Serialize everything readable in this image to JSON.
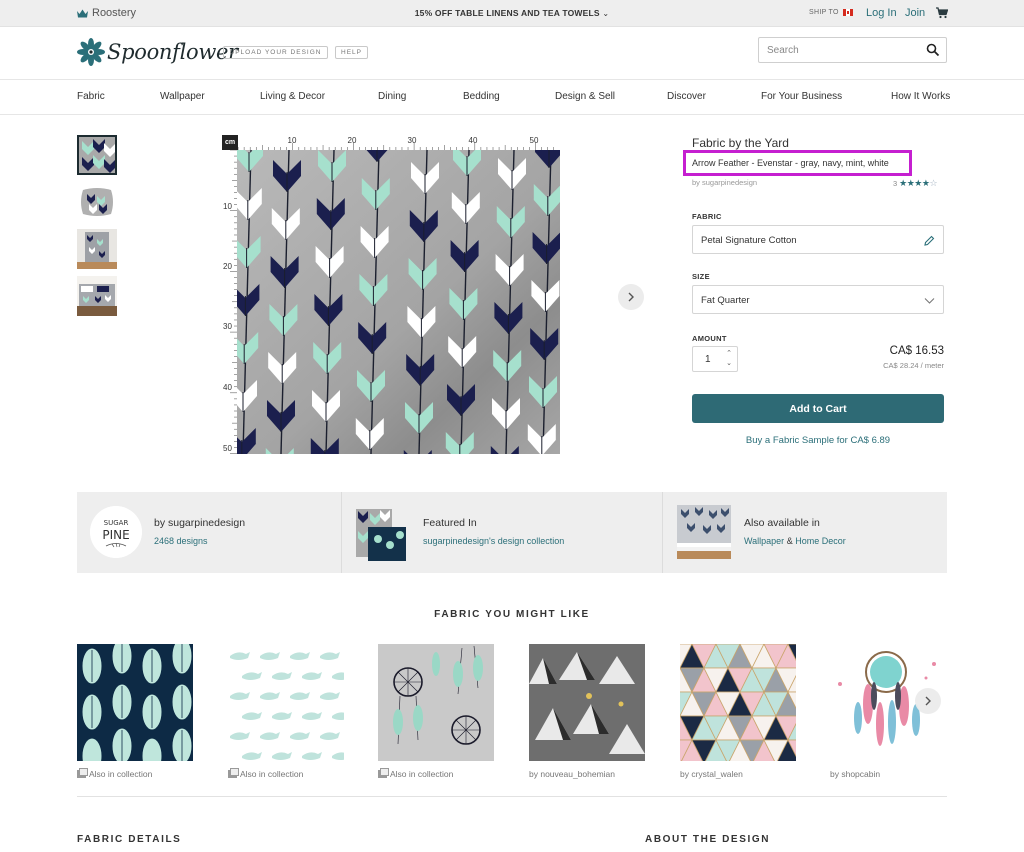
{
  "topbar": {
    "roostery": "Roostery",
    "promo": "15% OFF TABLE LINENS AND TEA TOWELS",
    "ship_to": "SHIP TO",
    "login": "Log In",
    "join": "Join"
  },
  "header": {
    "brand": "Spoonflower",
    "upload_button": "UPLOAD YOUR DESIGN",
    "help_button": "HELP",
    "search_placeholder": "Search"
  },
  "nav": [
    "Fabric",
    "Wallpaper",
    "Living & Decor",
    "Dining",
    "Bedding",
    "Design & Sell",
    "Discover",
    "For Your Business",
    "How It Works"
  ],
  "ruler": {
    "unit": "cm",
    "top_ticks": [
      "10",
      "20",
      "30",
      "40",
      "50"
    ],
    "left_ticks": [
      "10",
      "20",
      "30",
      "40",
      "50"
    ]
  },
  "product": {
    "title": "Fabric by the Yard",
    "design_name": "Arrow Feather - Evenstar - gray, navy, mint, white",
    "by_designer": "by sugarpinedesign",
    "rating_count": "3",
    "rating_value": 4,
    "fabric_label": "FABRIC",
    "fabric_value": "Petal Signature Cotton",
    "size_label": "SIZE",
    "size_value": "Fat Quarter",
    "amount_label": "AMOUNT",
    "quantity": "1",
    "price": "CA$ 16.53",
    "price_per_meter": "CA$ 28.24 / meter",
    "add_to_cart": "Add to Cart",
    "sample_link": "Buy a Fabric Sample for CA$ 6.89"
  },
  "info": {
    "designer_title": "by sugarpinedesign",
    "designer_designs": "2468 designs",
    "avatar_text_1": "SUGAR",
    "avatar_text_2": "PINE",
    "featured_title": "Featured In",
    "featured_link": "sugarpinedesign's design collection",
    "available_title": "Also available in",
    "available_link_1": "Wallpaper",
    "available_amp": "&",
    "available_link_2": "Home Decor"
  },
  "recommendations": {
    "title": "FABRIC YOU MIGHT LIKE",
    "items": [
      {
        "caption": "Also in collection"
      },
      {
        "caption": "Also in collection"
      },
      {
        "caption": "Also in collection"
      },
      {
        "caption": "by nouveau_bohemian"
      },
      {
        "caption": "by crystal_walen"
      },
      {
        "caption": "by shopcabin"
      }
    ]
  },
  "bottom": {
    "fabric_details": "FABRIC DETAILS",
    "about_design": "ABOUT THE DESIGN"
  },
  "colors": {
    "accent": "#2e6a75",
    "link": "#2b6f79",
    "highlight": "#c51fd0",
    "navy": "#1b1f4e",
    "mint": "#a6e0cd",
    "gray": "#a9a9a9"
  }
}
